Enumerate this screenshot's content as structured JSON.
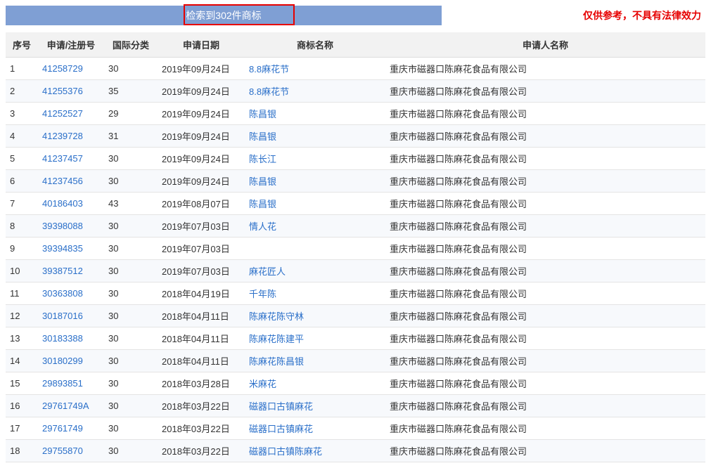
{
  "header": {
    "result_text": "检索到302件商标",
    "disclaimer": "仅供参考，不具有法律效力"
  },
  "columns": {
    "idx": "序号",
    "appno": "申请/注册号",
    "intclass": "国际分类",
    "date": "申请日期",
    "tmname": "商标名称",
    "applicant": "申请人名称"
  },
  "rows": [
    {
      "idx": "1",
      "appno": "41258729",
      "intclass": "30",
      "date": "2019年09月24日",
      "tmname": "8.8麻花节",
      "applicant": "重庆市磁器口陈麻花食品有限公司"
    },
    {
      "idx": "2",
      "appno": "41255376",
      "intclass": "35",
      "date": "2019年09月24日",
      "tmname": "8.8麻花节",
      "applicant": "重庆市磁器口陈麻花食品有限公司"
    },
    {
      "idx": "3",
      "appno": "41252527",
      "intclass": "29",
      "date": "2019年09月24日",
      "tmname": "陈昌银",
      "applicant": "重庆市磁器口陈麻花食品有限公司"
    },
    {
      "idx": "4",
      "appno": "41239728",
      "intclass": "31",
      "date": "2019年09月24日",
      "tmname": "陈昌银",
      "applicant": "重庆市磁器口陈麻花食品有限公司"
    },
    {
      "idx": "5",
      "appno": "41237457",
      "intclass": "30",
      "date": "2019年09月24日",
      "tmname": "陈长江",
      "applicant": "重庆市磁器口陈麻花食品有限公司"
    },
    {
      "idx": "6",
      "appno": "41237456",
      "intclass": "30",
      "date": "2019年09月24日",
      "tmname": "陈昌银",
      "applicant": "重庆市磁器口陈麻花食品有限公司"
    },
    {
      "idx": "7",
      "appno": "40186403",
      "intclass": "43",
      "date": "2019年08月07日",
      "tmname": "陈昌银",
      "applicant": "重庆市磁器口陈麻花食品有限公司"
    },
    {
      "idx": "8",
      "appno": "39398088",
      "intclass": "30",
      "date": "2019年07月03日",
      "tmname": "情人花",
      "applicant": "重庆市磁器口陈麻花食品有限公司"
    },
    {
      "idx": "9",
      "appno": "39394835",
      "intclass": "30",
      "date": "2019年07月03日",
      "tmname": "",
      "applicant": "重庆市磁器口陈麻花食品有限公司"
    },
    {
      "idx": "10",
      "appno": "39387512",
      "intclass": "30",
      "date": "2019年07月03日",
      "tmname": "麻花匠人",
      "applicant": "重庆市磁器口陈麻花食品有限公司"
    },
    {
      "idx": "11",
      "appno": "30363808",
      "intclass": "30",
      "date": "2018年04月19日",
      "tmname": "千年陈",
      "applicant": "重庆市磁器口陈麻花食品有限公司"
    },
    {
      "idx": "12",
      "appno": "30187016",
      "intclass": "30",
      "date": "2018年04月11日",
      "tmname": "陈麻花陈守林",
      "applicant": "重庆市磁器口陈麻花食品有限公司"
    },
    {
      "idx": "13",
      "appno": "30183388",
      "intclass": "30",
      "date": "2018年04月11日",
      "tmname": "陈麻花陈建平",
      "applicant": "重庆市磁器口陈麻花食品有限公司"
    },
    {
      "idx": "14",
      "appno": "30180299",
      "intclass": "30",
      "date": "2018年04月11日",
      "tmname": "陈麻花陈昌银",
      "applicant": "重庆市磁器口陈麻花食品有限公司"
    },
    {
      "idx": "15",
      "appno": "29893851",
      "intclass": "30",
      "date": "2018年03月28日",
      "tmname": "米麻花",
      "applicant": "重庆市磁器口陈麻花食品有限公司"
    },
    {
      "idx": "16",
      "appno": "29761749A",
      "intclass": "30",
      "date": "2018年03月22日",
      "tmname": "磁器口古镇麻花",
      "applicant": "重庆市磁器口陈麻花食品有限公司"
    },
    {
      "idx": "17",
      "appno": "29761749",
      "intclass": "30",
      "date": "2018年03月22日",
      "tmname": "磁器口古镇麻花",
      "applicant": "重庆市磁器口陈麻花食品有限公司"
    },
    {
      "idx": "18",
      "appno": "29755870",
      "intclass": "30",
      "date": "2018年03月22日",
      "tmname": "磁器口古镇陈麻花",
      "applicant": "重庆市磁器口陈麻花食品有限公司"
    }
  ]
}
